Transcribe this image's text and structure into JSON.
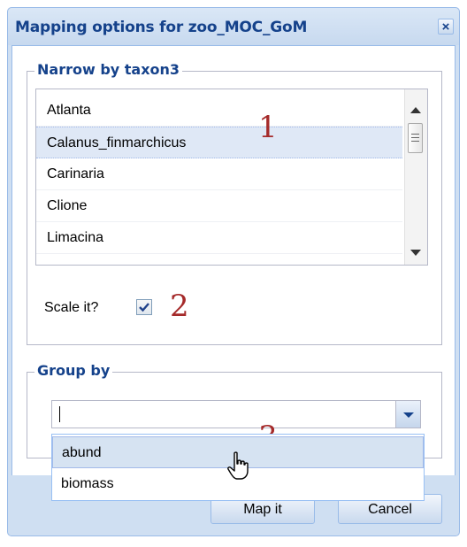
{
  "window": {
    "title": "Mapping options for zoo_MOC_GoM",
    "close_label": "×"
  },
  "taxon_section": {
    "legend": "Narrow by taxon3",
    "items": [
      {
        "label": "Atlanta",
        "selected": false
      },
      {
        "label": "Calanus_finmarchicus",
        "selected": true
      },
      {
        "label": "Carinaria",
        "selected": false
      },
      {
        "label": "Clione",
        "selected": false
      },
      {
        "label": "Limacina",
        "selected": false
      }
    ]
  },
  "scale": {
    "label": "Scale it?",
    "checked": true,
    "check_glyph": "✓"
  },
  "group_section": {
    "legend": "Group by",
    "value": "",
    "options": [
      {
        "label": "abund",
        "hover": true
      },
      {
        "label": "biomass",
        "hover": false
      }
    ]
  },
  "buttons": {
    "map": "Map it",
    "cancel": "Cancel"
  },
  "annotations": [
    "1",
    "2",
    "3"
  ],
  "colors": {
    "title": "#15428b",
    "annotation": "#a52a2a",
    "selected": "#dfe8f6"
  }
}
